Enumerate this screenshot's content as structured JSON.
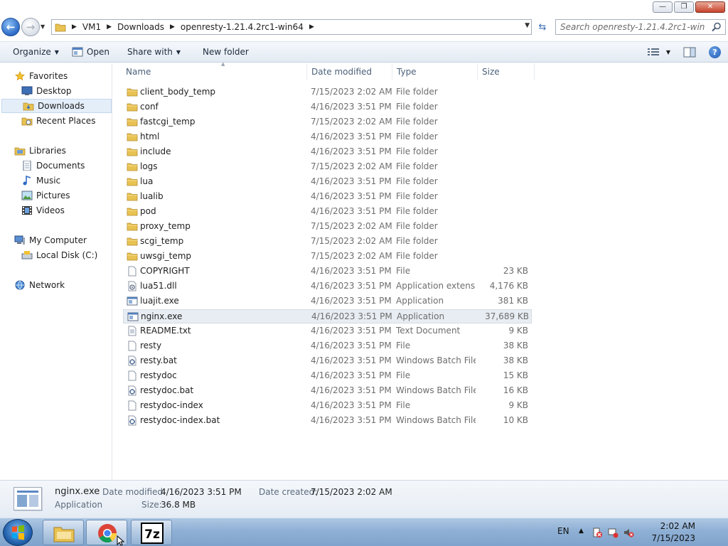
{
  "window": {
    "controls": {
      "minimize": "—",
      "maximize": "❐",
      "close": "✕"
    }
  },
  "address": {
    "breadcrumbs": [
      "VM1",
      "Downloads",
      "openresty-1.21.4.2rc1-win64"
    ],
    "search_placeholder": "Search openresty-1.21.4.2rc1-win64"
  },
  "toolbar": {
    "organize": "Organize",
    "open": "Open",
    "share_with": "Share with",
    "new_folder": "New folder"
  },
  "nav": {
    "favorites": "Favorites",
    "desktop": "Desktop",
    "downloads": "Downloads",
    "recent_places": "Recent Places",
    "libraries": "Libraries",
    "documents": "Documents",
    "music": "Music",
    "pictures": "Pictures",
    "videos": "Videos",
    "my_computer": "My Computer",
    "local_disk": "Local Disk (C:)",
    "network": "Network"
  },
  "columns": {
    "name": "Name",
    "date_modified": "Date modified",
    "type": "Type",
    "size": "Size"
  },
  "files": [
    {
      "name": "client_body_temp",
      "date": "7/15/2023 2:02 AM",
      "type": "File folder",
      "size": "",
      "icon": "folder-icon"
    },
    {
      "name": "conf",
      "date": "4/16/2023 3:51 PM",
      "type": "File folder",
      "size": "",
      "icon": "folder-icon"
    },
    {
      "name": "fastcgi_temp",
      "date": "7/15/2023 2:02 AM",
      "type": "File folder",
      "size": "",
      "icon": "folder-icon"
    },
    {
      "name": "html",
      "date": "4/16/2023 3:51 PM",
      "type": "File folder",
      "size": "",
      "icon": "folder-icon"
    },
    {
      "name": "include",
      "date": "4/16/2023 3:51 PM",
      "type": "File folder",
      "size": "",
      "icon": "folder-icon"
    },
    {
      "name": "logs",
      "date": "7/15/2023 2:02 AM",
      "type": "File folder",
      "size": "",
      "icon": "folder-icon"
    },
    {
      "name": "lua",
      "date": "4/16/2023 3:51 PM",
      "type": "File folder",
      "size": "",
      "icon": "folder-icon"
    },
    {
      "name": "lualib",
      "date": "4/16/2023 3:51 PM",
      "type": "File folder",
      "size": "",
      "icon": "folder-icon"
    },
    {
      "name": "pod",
      "date": "4/16/2023 3:51 PM",
      "type": "File folder",
      "size": "",
      "icon": "folder-icon"
    },
    {
      "name": "proxy_temp",
      "date": "7/15/2023 2:02 AM",
      "type": "File folder",
      "size": "",
      "icon": "folder-icon"
    },
    {
      "name": "scgi_temp",
      "date": "7/15/2023 2:02 AM",
      "type": "File folder",
      "size": "",
      "icon": "folder-icon"
    },
    {
      "name": "uwsgi_temp",
      "date": "7/15/2023 2:02 AM",
      "type": "File folder",
      "size": "",
      "icon": "folder-icon"
    },
    {
      "name": "COPYRIGHT",
      "date": "4/16/2023 3:51 PM",
      "type": "File",
      "size": "23 KB",
      "icon": "file-icon"
    },
    {
      "name": "lua51.dll",
      "date": "4/16/2023 3:51 PM",
      "type": "Application extens...",
      "size": "4,176 KB",
      "icon": "dll-icon"
    },
    {
      "name": "luajit.exe",
      "date": "4/16/2023 3:51 PM",
      "type": "Application",
      "size": "381 KB",
      "icon": "exe-icon"
    },
    {
      "name": "nginx.exe",
      "date": "4/16/2023 3:51 PM",
      "type": "Application",
      "size": "37,689 KB",
      "icon": "exe-icon",
      "selected": true
    },
    {
      "name": "README.txt",
      "date": "4/16/2023 3:51 PM",
      "type": "Text Document",
      "size": "9 KB",
      "icon": "text-file-icon"
    },
    {
      "name": "resty",
      "date": "4/16/2023 3:51 PM",
      "type": "File",
      "size": "38 KB",
      "icon": "file-icon"
    },
    {
      "name": "resty.bat",
      "date": "4/16/2023 3:51 PM",
      "type": "Windows Batch File",
      "size": "38 KB",
      "icon": "batch-file-icon"
    },
    {
      "name": "restydoc",
      "date": "4/16/2023 3:51 PM",
      "type": "File",
      "size": "15 KB",
      "icon": "file-icon"
    },
    {
      "name": "restydoc.bat",
      "date": "4/16/2023 3:51 PM",
      "type": "Windows Batch File",
      "size": "16 KB",
      "icon": "batch-file-icon"
    },
    {
      "name": "restydoc-index",
      "date": "4/16/2023 3:51 PM",
      "type": "File",
      "size": "9 KB",
      "icon": "file-icon"
    },
    {
      "name": "restydoc-index.bat",
      "date": "4/16/2023 3:51 PM",
      "type": "Windows Batch File",
      "size": "10 KB",
      "icon": "batch-file-icon"
    }
  ],
  "details": {
    "name": "nginx.exe",
    "type": "Application",
    "date_modified_label": "Date modified:",
    "date_modified": "4/16/2023 3:51 PM",
    "date_created_label": "Date created:",
    "date_created": "7/15/2023 2:02 AM",
    "size_label": "Size:",
    "size": "36.8 MB"
  },
  "taskbar": {
    "apps": [
      "explorer-icon",
      "chrome-icon",
      "7zip-icon"
    ],
    "language": "EN",
    "time": "2:02 AM",
    "date": "7/15/2023"
  },
  "colors": {
    "accent": "#2e6bc7",
    "selection": "#e4eef9",
    "folder": "#e8c252",
    "taskbar": "#8fb0d5"
  }
}
